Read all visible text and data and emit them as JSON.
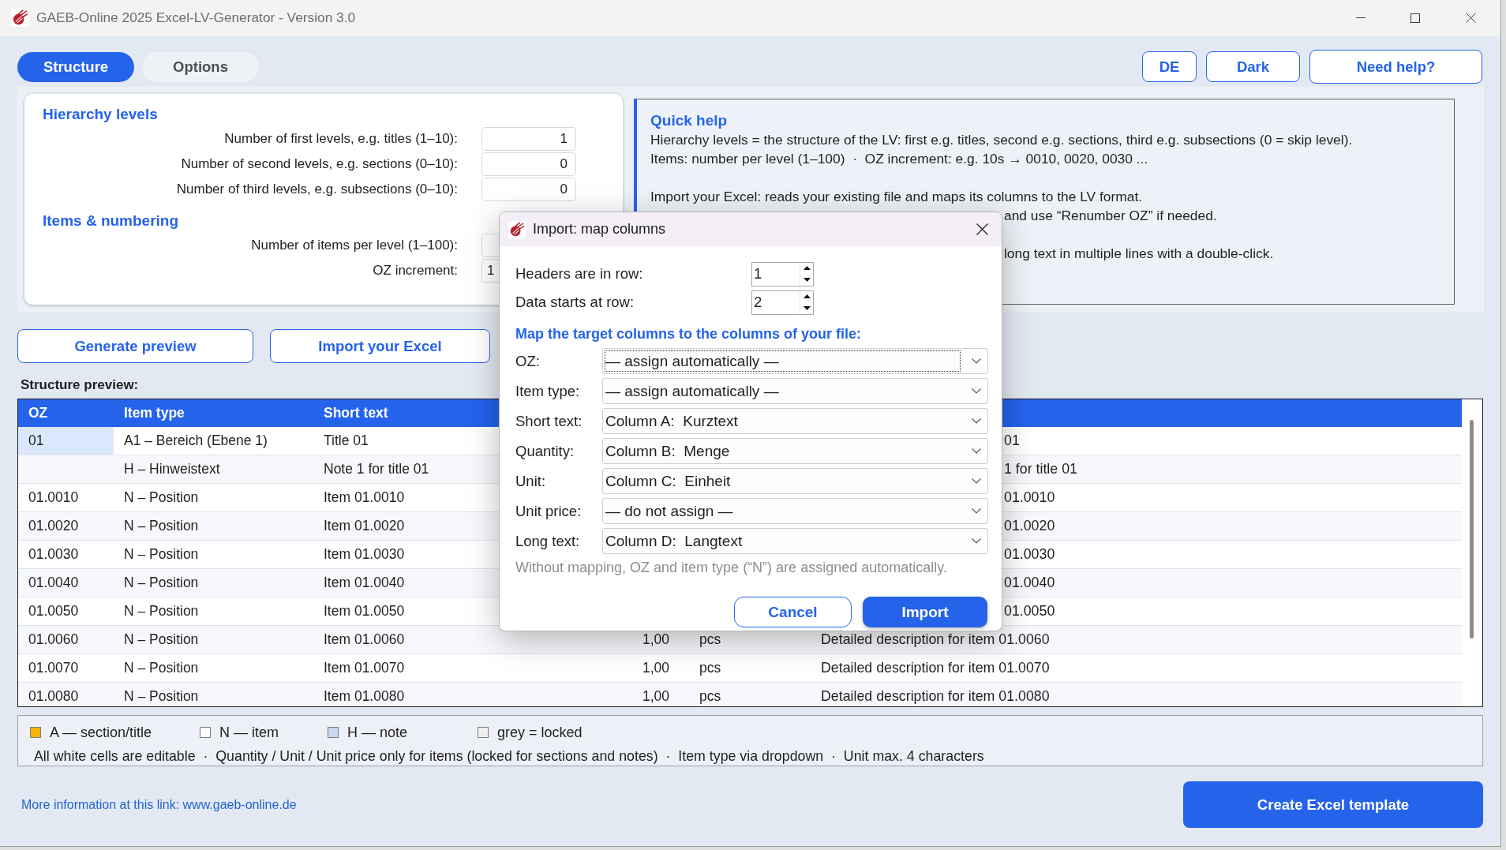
{
  "window": {
    "title": "GAEB-Online 2025 Excel-LV-Generator - Version 3.0"
  },
  "tabs": [
    {
      "label": "Structure",
      "selected": true
    },
    {
      "label": "Options",
      "selected": false
    }
  ],
  "header_buttons": [
    "DE",
    "Dark",
    "Need help?"
  ],
  "settings": {
    "sections": [
      {
        "title": "Hierarchy levels",
        "fields": [
          {
            "label": "Number of first levels, e.g. titles (1–10):",
            "value": "1",
            "kind": "number",
            "covered": false
          },
          {
            "label": "Number of second levels, e.g. sections (0–10):",
            "value": "0",
            "kind": "number",
            "covered": false
          },
          {
            "label": "Number of third levels, e.g. subsections (0–10):",
            "value": "0",
            "kind": "number",
            "covered": false
          }
        ]
      },
      {
        "title": "Items & numbering",
        "fields": [
          {
            "label": "Number of items per level (1–100):",
            "kind": "number",
            "covered": true
          },
          {
            "label": "OZ increment:",
            "value": "1",
            "kind": "text",
            "covered": true
          }
        ]
      }
    ]
  },
  "quick_help": {
    "title": "Quick help",
    "paragraphs": [
      {
        "lines": [
          {
            "text": "Hierarchy levels = the structure of the LV: first e.g. titles, second e.g. sections, third e.g. subsections (0 = skip level).",
            "covered": false
          },
          {
            "text": "Items: number per level (1–100)  ·  OZ increment: e.g. 10s → 0010, 0020, 0030 ...",
            "covered": false
          }
        ]
      },
      {
        "lines": [
          {
            "text": "Import your Excel: reads your existing file and maps its columns to the LV format.",
            "covered": false
          },
          {
            "text": "and use “Renumber OZ” if needed.",
            "covered": true
          }
        ]
      },
      {
        "lines": [
          {
            "text": "long text in multiple lines with a double-click.",
            "covered": true
          }
        ]
      }
    ]
  },
  "actions": [
    "Generate preview",
    "Import your Excel"
  ],
  "preview": {
    "label": "Structure preview:",
    "columns": [
      "OZ",
      "Item type",
      "Short text"
    ],
    "rows": [
      {
        "oz": "01",
        "item_type": "A1 – Bereich (Ebene 1)",
        "short_text": "Title 01",
        "long_text_end": "01",
        "selected": true
      },
      {
        "item_type": "H – Hinweistext",
        "short_text": "Note 1 for title 01",
        "long_text_end": "1 for title 01",
        "selected": false
      },
      {
        "oz": "01.0010",
        "item_type": "N – Position",
        "short_text": "Item 01.0010",
        "long_text_end": "01.0010",
        "selected": false
      },
      {
        "oz": "01.0020",
        "item_type": "N – Position",
        "short_text": "Item 01.0020",
        "long_text_end": "01.0020",
        "selected": false
      },
      {
        "oz": "01.0030",
        "item_type": "N – Position",
        "short_text": "Item 01.0030",
        "long_text_end": "01.0030",
        "selected": false
      },
      {
        "oz": "01.0040",
        "item_type": "N – Position",
        "short_text": "Item 01.0040",
        "long_text_end": "01.0040",
        "selected": false
      },
      {
        "oz": "01.0050",
        "item_type": "N – Position",
        "short_text": "Item 01.0050",
        "long_text_end": "01.0050",
        "selected": false
      },
      {
        "oz": "01.0060",
        "item_type": "N – Position",
        "short_text": "Item 01.0060",
        "quantity": "1,00",
        "unit": "pcs",
        "long_text": "Detailed description for item 01.0060",
        "selected": false
      },
      {
        "oz": "01.0070",
        "item_type": "N – Position",
        "short_text": "Item 01.0070",
        "quantity": "1,00",
        "unit": "pcs",
        "long_text": "Detailed description for item 01.0070",
        "selected": false
      },
      {
        "oz": "01.0080",
        "item_type": "N – Position",
        "short_text": "Item 01.0080",
        "quantity": "1,00",
        "unit": "pcs",
        "long_text": "Detailed description for item 01.0080",
        "selected": false
      }
    ]
  },
  "legend": {
    "items": [
      {
        "label": "A — section/title",
        "color": "#f5b400"
      },
      {
        "label": "N — item",
        "color": "#ffffff"
      },
      {
        "label": "H — note",
        "color": "#c6d9f0"
      },
      {
        "label": "grey = locked",
        "color": "#efefef"
      }
    ],
    "note": "All white cells are editable  ·  Quantity / Unit / Unit price only for items (locked for sections and notes)  ·  Item type via dropdown  ·  Unit max. 4 characters"
  },
  "footer": {
    "link": "More information at this link: www.gaeb-online.de",
    "button": "Create Excel template"
  },
  "import_dialog": {
    "title": "Import: map columns",
    "spin_fields": [
      {
        "label": "Headers are in row:",
        "value": "1"
      },
      {
        "label": "Data starts at row:",
        "value": "2"
      }
    ],
    "mapping_heading": "Map the target columns to the columns of your file:",
    "mappings": [
      {
        "label": "OZ:",
        "value": "— assign automatically —",
        "focused": true
      },
      {
        "label": "Item type:",
        "value": "— assign automatically —",
        "focused": false
      },
      {
        "label": "Short text:",
        "value": "Column A:  Kurztext",
        "focused": false
      },
      {
        "label": "Quantity:",
        "value": "Column B:  Menge",
        "focused": false
      },
      {
        "label": "Unit:",
        "value": "Column C:  Einheit",
        "focused": false
      },
      {
        "label": "Unit price:",
        "value": "— do not assign —",
        "focused": false
      },
      {
        "label": "Long text:",
        "value": "Column D:  Langtext",
        "focused": false
      }
    ],
    "hint": "Without mapping, OZ and item type (“N”) are assigned automatically.",
    "buttons": [
      {
        "label": "Cancel",
        "kind": "secondary"
      },
      {
        "label": "Import",
        "kind": "primary"
      }
    ]
  }
}
